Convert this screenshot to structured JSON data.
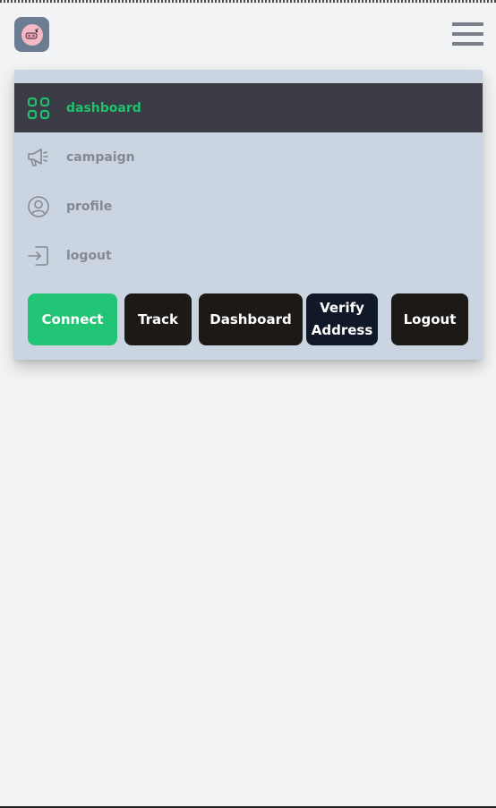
{
  "header": {
    "logo": "pig-face-logo",
    "menu_icon": "hamburger-icon"
  },
  "menu": {
    "items": [
      {
        "label": "dashboard",
        "icon": "grid-icon",
        "active": true
      },
      {
        "label": "campaign",
        "icon": "megaphone-icon",
        "active": false
      },
      {
        "label": "profile",
        "icon": "user-circle-icon",
        "active": false
      },
      {
        "label": "logout",
        "icon": "logout-icon",
        "active": false
      }
    ]
  },
  "actions": {
    "connect_label": "Connect",
    "track_label": "Track",
    "dashboard_label": "Dashboard",
    "verify_label": "Verify Address",
    "logout_label": "Logout"
  },
  "colors": {
    "accent": "#22c576",
    "active_bg": "#3a3b44",
    "panel_bg": "#cbd5e1",
    "page_bg": "#f2f3f5"
  }
}
